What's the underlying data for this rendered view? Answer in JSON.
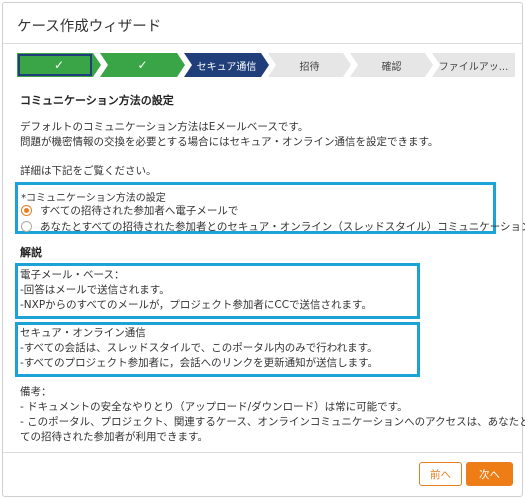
{
  "dialog": {
    "title": "ケース作成ウィザード"
  },
  "stepper": {
    "steps": [
      {
        "label": "✓",
        "state": "done"
      },
      {
        "label": "✓",
        "state": "done"
      },
      {
        "label": "セキュア通信",
        "state": "active"
      },
      {
        "label": "招待",
        "state": "pending"
      },
      {
        "label": "確認",
        "state": "pending"
      },
      {
        "label": "ファイルアッ...",
        "state": "pending"
      }
    ],
    "colors": {
      "done": "#3aa547",
      "active": "#1f3e7a",
      "pending": "#e6e6e6"
    }
  },
  "section": {
    "title": "コミュニケーション方法の設定",
    "intro_line1": "デフォルトのコミュニケーション方法はEメールベースです。",
    "intro_line2": "問題が機密情報の交換を必要とする場合にはセキュア・オンライン通信を設定できます。",
    "details": "詳細は下記をご覧ください。"
  },
  "method": {
    "label": "*コミュニケーション方法の設定",
    "options": [
      {
        "label": "すべての招待された参加者へ電子メールで",
        "checked": true
      },
      {
        "label": "あなたとすべての招待された参加者とのセキュア・オンライン（スレッドスタイル）コミュニケーション",
        "checked": false
      }
    ]
  },
  "explanation": {
    "title": "解説",
    "email": {
      "heading": "電子メール・ベース：",
      "line1": "-回答はメールで送信されます。",
      "line2": "-NXPからのすべてのメールが，プロジェクト参加者にCCで送信されます。"
    },
    "secure": {
      "heading": "セキュア・オンライン通信",
      "line1": "-すべての会話は、スレッドスタイルで、このポータル内のみで行われます。",
      "line2": "-すべてのプロジェクト参加者に，会話へのリンクを更新通知が送信します。"
    }
  },
  "notes": {
    "heading": "備考：",
    "line1": "- ドキュメントの安全なやりとり（アップロード/ダウンロード）は常に可能です。",
    "line2": "- このポータル、プロジェクト、関連するケース、オンラインコミュニケーションへのアクセスは、あなたとすべ",
    "line3": "ての招待された参加者が利用できます。"
  },
  "footer": {
    "prev": "前へ",
    "next": "次へ"
  },
  "highlight_color": "#1ba3d8"
}
